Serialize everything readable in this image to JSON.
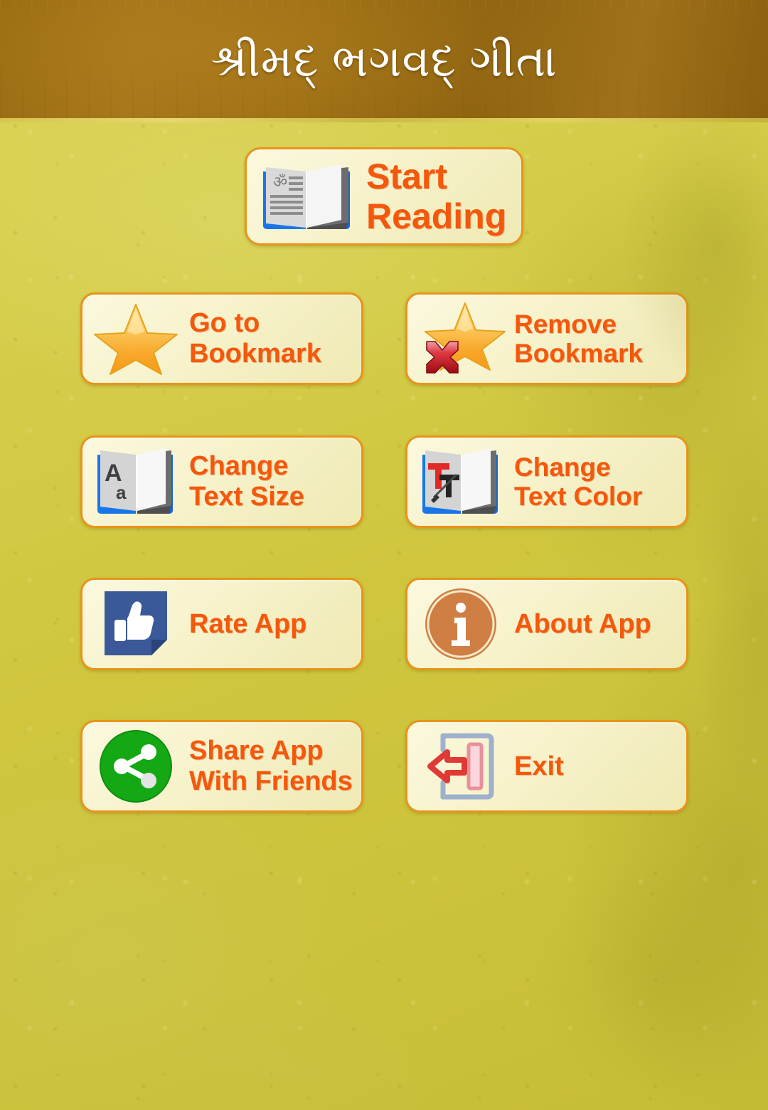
{
  "app": {
    "title": "શ્રીમદ્ ભગવદ્ ગીતા",
    "background_color": "#cfc63e",
    "header_color": "#9a6c12",
    "button_face_color": "#f7f3cd",
    "button_border_color": "#e8941a",
    "label_color": "#f4580c"
  },
  "menu": {
    "primary": {
      "id": "start-reading",
      "label": "Start\nReading",
      "icon": "open-book-om-icon"
    },
    "items": [
      {
        "id": "go-to-bookmark",
        "label": "Go to\nBookmark",
        "icon": "star-icon"
      },
      {
        "id": "remove-bookmark",
        "label": "Remove\nBookmark",
        "icon": "star-with-red-x-icon"
      },
      {
        "id": "change-text-size",
        "label": "Change\nText Size",
        "icon": "book-font-size-icon"
      },
      {
        "id": "change-text-color",
        "label": "Change\nText Color",
        "icon": "book-text-color-icon"
      },
      {
        "id": "rate-app",
        "label": "Rate App",
        "icon": "thumbs-up-icon"
      },
      {
        "id": "about-app",
        "label": "About App",
        "icon": "info-circle-icon"
      },
      {
        "id": "share-app",
        "label": "Share App\nWith Friends",
        "icon": "share-nodes-icon"
      },
      {
        "id": "exit",
        "label": "Exit",
        "icon": "exit-door-arrow-icon"
      }
    ]
  }
}
